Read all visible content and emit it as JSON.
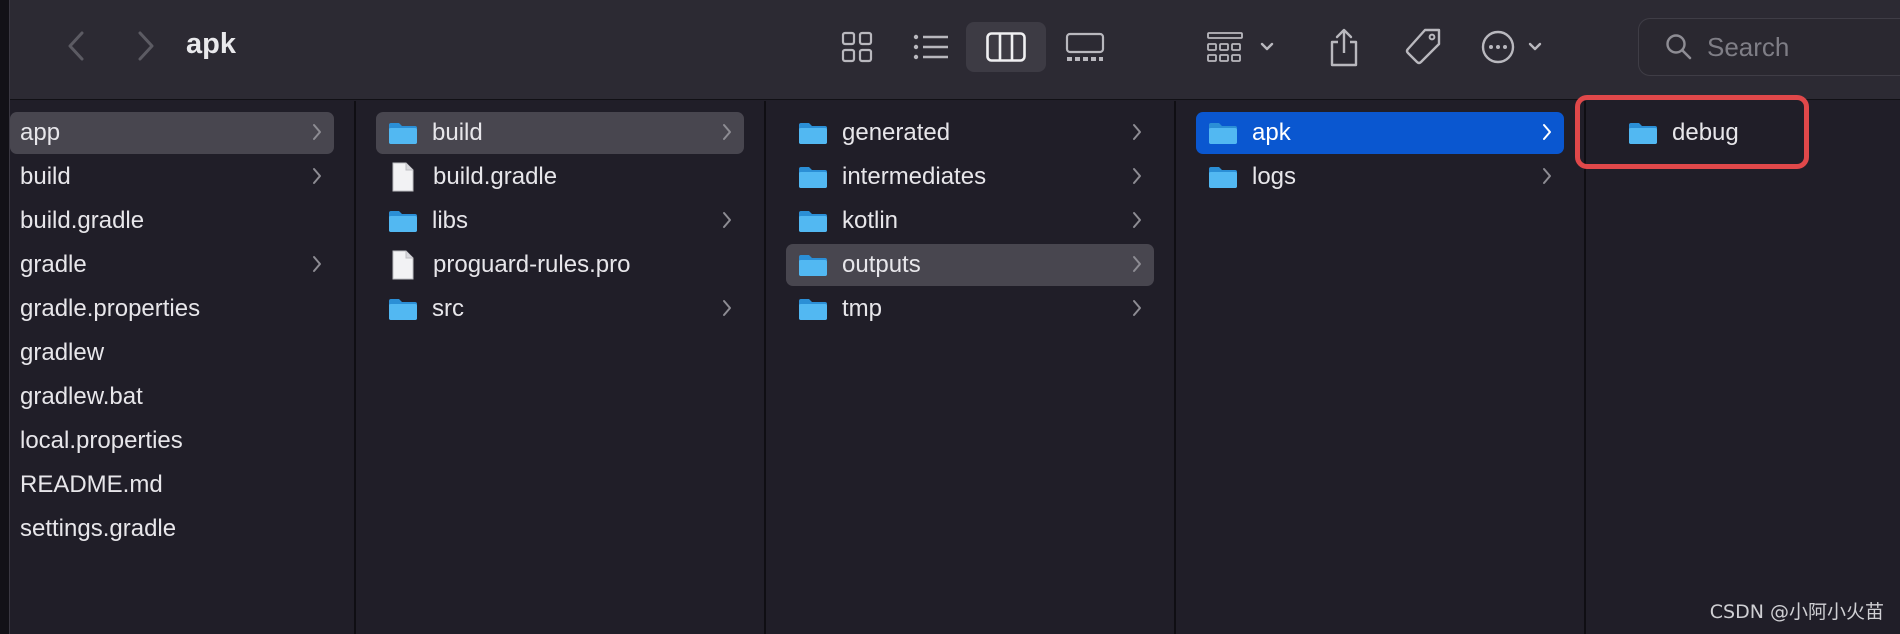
{
  "window": {
    "title": "apk"
  },
  "toolbar": {
    "back_icon": "chevron-left-icon",
    "forward_icon": "chevron-right-icon",
    "view_icons": [
      "icon-view-icon",
      "list-view-icon",
      "column-view-icon",
      "gallery-view-icon"
    ],
    "selected_view": "column-view-icon",
    "group_icon": "group-grid-icon",
    "share_icon": "share-icon",
    "tag_icon": "tag-icon",
    "more_icon": "ellipsis-circle-icon",
    "search_placeholder": "Search"
  },
  "columns": [
    {
      "items": [
        {
          "label": "app",
          "type": "none",
          "has_children": true,
          "selected": "gray"
        },
        {
          "label": "build",
          "type": "none",
          "has_children": true
        },
        {
          "label": "build.gradle",
          "type": "none",
          "has_children": false
        },
        {
          "label": "gradle",
          "type": "none",
          "has_children": true
        },
        {
          "label": "gradle.properties",
          "type": "none",
          "has_children": false
        },
        {
          "label": "gradlew",
          "type": "none",
          "has_children": false
        },
        {
          "label": "gradlew.bat",
          "type": "none",
          "has_children": false
        },
        {
          "label": "local.properties",
          "type": "none",
          "has_children": false
        },
        {
          "label": "README.md",
          "type": "none",
          "has_children": false
        },
        {
          "label": "settings.gradle",
          "type": "none",
          "has_children": false
        }
      ]
    },
    {
      "items": [
        {
          "label": "build",
          "type": "folder",
          "has_children": true,
          "selected": "gray"
        },
        {
          "label": "build.gradle",
          "type": "file",
          "has_children": false
        },
        {
          "label": "libs",
          "type": "folder",
          "has_children": true
        },
        {
          "label": "proguard-rules.pro",
          "type": "file",
          "has_children": false
        },
        {
          "label": "src",
          "type": "folder",
          "has_children": true
        }
      ]
    },
    {
      "items": [
        {
          "label": "generated",
          "type": "folder",
          "has_children": true
        },
        {
          "label": "intermediates",
          "type": "folder",
          "has_children": true
        },
        {
          "label": "kotlin",
          "type": "folder",
          "has_children": true
        },
        {
          "label": "outputs",
          "type": "folder",
          "has_children": true,
          "selected": "gray"
        },
        {
          "label": "tmp",
          "type": "folder",
          "has_children": true
        }
      ]
    },
    {
      "items": [
        {
          "label": "apk",
          "type": "folder",
          "has_children": true,
          "selected": "blue"
        },
        {
          "label": "logs",
          "type": "folder",
          "has_children": true
        }
      ]
    },
    {
      "items": [
        {
          "label": "debug",
          "type": "folder",
          "has_children": false
        }
      ]
    }
  ],
  "annotation": {
    "highlight_color": "#e0484a",
    "highlighted_item": "debug"
  },
  "watermark": "CSDN @小阿小火苗",
  "colors": {
    "selection_blue": "#0a57d0",
    "selection_gray": "#48464f",
    "folder_blue": "#3aa6e8"
  }
}
